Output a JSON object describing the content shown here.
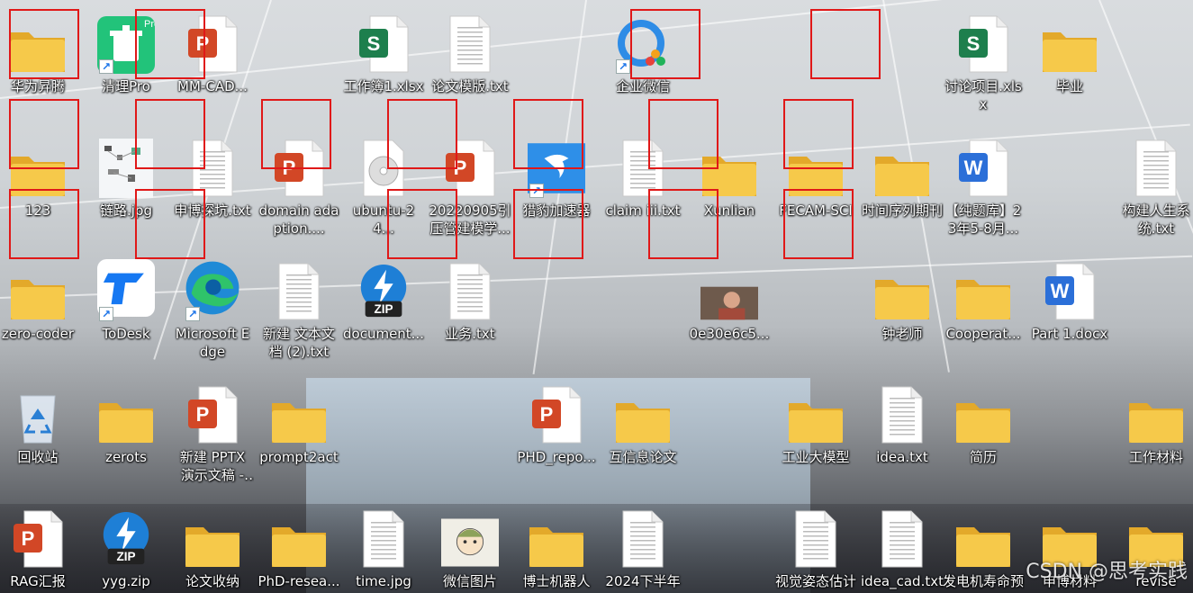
{
  "colors": {
    "folder": "#f6c94a",
    "folder_dark": "#e3a92a",
    "ppt": "#d24726",
    "excel": "#1d7f4d",
    "word": "#2b6fd8",
    "highlight": "#e01818"
  },
  "desktop": {
    "icons": [
      {
        "label": "华为昇腾",
        "type": "folder"
      },
      {
        "label": "清理Pro",
        "type": "app-cleaner",
        "shortcut": true
      },
      {
        "label": "MM-CAD...",
        "type": "ppt"
      },
      {
        "label": "工作簿1.xlsx",
        "type": "excel"
      },
      {
        "label": "论文模版.txt",
        "type": "txt"
      },
      {
        "label": "企业微信",
        "type": "app-wecom",
        "shortcut": true
      },
      {
        "label": "讨论项目.xlsx",
        "type": "excel"
      },
      {
        "label": "毕业",
        "type": "folder"
      },
      {
        "label": "123",
        "type": "folder"
      },
      {
        "label": "链路.jpg",
        "type": "image"
      },
      {
        "label": "申博探坑.txt",
        "type": "txt"
      },
      {
        "label": "domain adaption....",
        "type": "ppt"
      },
      {
        "label": "ubuntu-24...",
        "type": "disc"
      },
      {
        "label": "20220905引压管建模学...",
        "type": "ppt"
      },
      {
        "label": "猎豹加速器",
        "type": "app-cheetah",
        "shortcut": true
      },
      {
        "label": "claim iii.txt",
        "type": "txt"
      },
      {
        "label": "Xunlian",
        "type": "folder"
      },
      {
        "label": "FECAM-SCI",
        "type": "folder"
      },
      {
        "label": "时间序列期刊",
        "type": "folder"
      },
      {
        "label": "【纯题库】23年5-8月...",
        "type": "word"
      },
      {
        "label": "构建人生系统.txt",
        "type": "txt"
      },
      {
        "label": "zero-coder",
        "type": "folder"
      },
      {
        "label": "ToDesk",
        "type": "app-todesk",
        "shortcut": true
      },
      {
        "label": "Microsoft Edge",
        "type": "app-edge",
        "shortcut": true
      },
      {
        "label": "新建 文本文档 (2).txt",
        "type": "txt"
      },
      {
        "label": "document...",
        "type": "zip"
      },
      {
        "label": "业务.txt",
        "type": "txt"
      },
      {
        "label": "0e30e6c5...",
        "type": "photo"
      },
      {
        "label": "钟老师",
        "type": "folder"
      },
      {
        "label": "Cooperat...",
        "type": "folder"
      },
      {
        "label": "Part 1.docx",
        "type": "word"
      },
      {
        "label": "回收站",
        "type": "recycle"
      },
      {
        "label": "zerots",
        "type": "folder"
      },
      {
        "label": "新建 PPTX 演示文稿 - 副...",
        "type": "ppt"
      },
      {
        "label": "prompt2act",
        "type": "folder"
      },
      {
        "label": "PHD_repo...",
        "type": "ppt"
      },
      {
        "label": "互信息论文",
        "type": "folder"
      },
      {
        "label": "工业大模型",
        "type": "folder"
      },
      {
        "label": "idea.txt",
        "type": "txt"
      },
      {
        "label": "简历",
        "type": "folder"
      },
      {
        "label": "工作材料",
        "type": "folder"
      },
      {
        "label": "RAG汇报",
        "type": "ppt"
      },
      {
        "label": "yyg.zip",
        "type": "zip"
      },
      {
        "label": "论文收纳",
        "type": "folder"
      },
      {
        "label": "PhD-resea...",
        "type": "folder"
      },
      {
        "label": "time.jpg",
        "type": "txt"
      },
      {
        "label": "微信图片",
        "type": "photo2"
      },
      {
        "label": "博士机器人",
        "type": "folder"
      },
      {
        "label": "2024下半年",
        "type": "txt"
      },
      {
        "label": "视觉姿态估计",
        "type": "txt"
      },
      {
        "label": "idea_cad.txt",
        "type": "txt"
      },
      {
        "label": "发电机寿命预",
        "type": "folder"
      },
      {
        "label": "申博材料",
        "type": "folder"
      },
      {
        "label": "revise",
        "type": "folder"
      }
    ]
  },
  "watermark": "CSDN @思考实践"
}
